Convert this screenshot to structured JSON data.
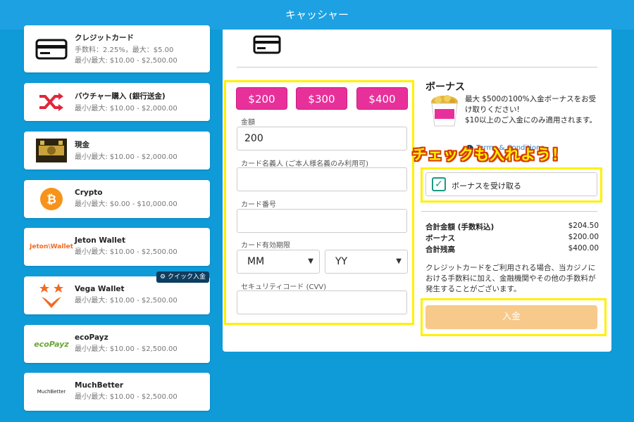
{
  "header": {
    "title": "キャッシャー"
  },
  "payment_methods": [
    {
      "name": "クレジットカード",
      "line1": "手数料：2.25%，最大：$5.00",
      "line2": "最小/最大: $10.00 - $2,500.00",
      "icon": "credit-card-icon"
    },
    {
      "name": "バウチャー購入 (銀行送金)",
      "line1": "最小/最大: $10.00 - $2,000.00",
      "icon": "shuffle-icon"
    },
    {
      "name": "現金",
      "line1": "最小/最大: $10.00 - $2,000.00",
      "icon": "cash-icon"
    },
    {
      "name": "Crypto",
      "line1": "最小/最大: $0.00 - $10,000.00",
      "icon": "bitcoin-icon"
    },
    {
      "name": "Jeton Wallet",
      "line1": "最小/最大: $10.00 - $2,500.00",
      "icon": "jeton-logo",
      "logo_text": "Jeton\\Wallet"
    },
    {
      "name": "Vega Wallet",
      "line1": "最小/最大: $10.00 - $2,500.00",
      "icon": "vega-logo",
      "badge": "クイック入金"
    },
    {
      "name": "ecoPayz",
      "line1": "最小/最大: $10.00 - $2,500.00",
      "icon": "ecopayz-logo",
      "logo_text": "ecoPayz"
    },
    {
      "name": "MuchBetter",
      "line1": "最小/最大: $10.00 - $2,500.00",
      "icon": "muchbetter-logo",
      "logo_text": "MuchBetter"
    }
  ],
  "form": {
    "amount_buttons": [
      "$200",
      "$300",
      "$400"
    ],
    "amount_label": "金額",
    "amount_value": "200",
    "cardholder_label": "カード名義人 (ご本人様名義のみ利用可)",
    "card_number_label": "カード番号",
    "expiry_label": "カード有効期限",
    "month_value": "MM",
    "year_value": "YY",
    "cvv_label": "セキュリティコード (CVV)"
  },
  "bonus": {
    "title": "ボーナス",
    "description": "最大 $500の100%入金ボーナスをお受け取りください!",
    "min_note": "$10以上のご入金にのみ適用されます。",
    "terms_text": "Terms & Conditions",
    "checkbox_label": "ボーナスを受け取る",
    "checked": true
  },
  "annotation": "チェックも入れよう！",
  "summary": [
    {
      "label": "合計金額 (手数料込)",
      "value": "$204.50"
    },
    {
      "label": "ボーナス",
      "value": "$200.00"
    },
    {
      "label": "合計残高",
      "value": "$400.00"
    }
  ],
  "fee_note": "クレジットカードをご利用される場合、当カジノにおける手数料に加え、金融機関やその他の手数料が発生することがございます。",
  "deposit_label": "入金",
  "colors": {
    "background": "#0f9ad8",
    "amount_button": "#e8309b",
    "deposit": "#f7c98a",
    "highlight": "#fff000",
    "checkbox": "#1a9a83"
  }
}
